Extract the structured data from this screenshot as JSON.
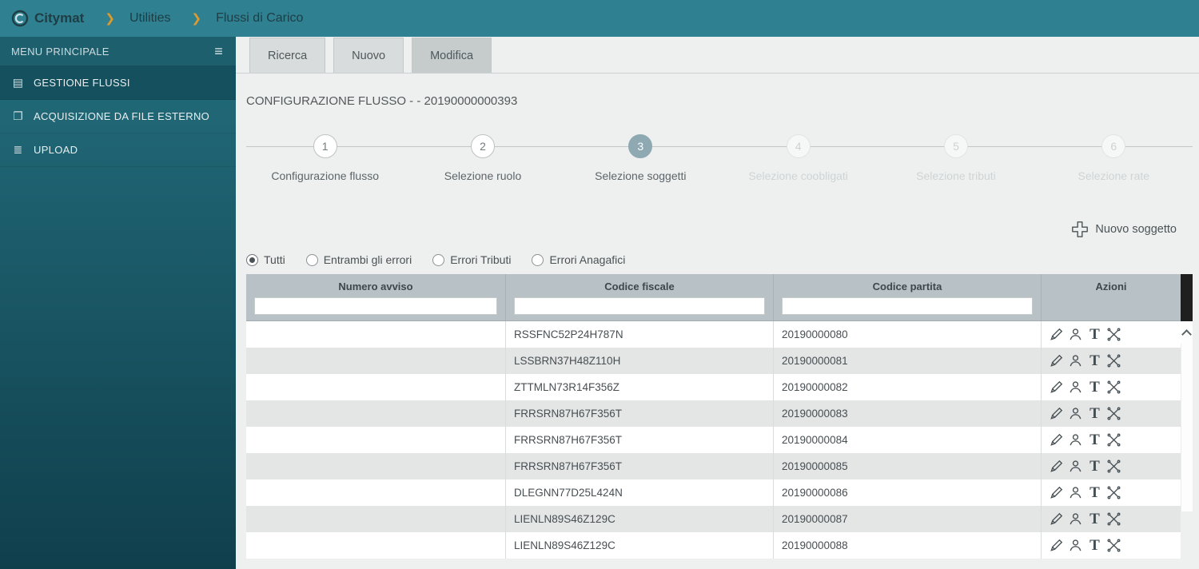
{
  "topbar": {
    "brand": "Citymat",
    "breadcrumbs": [
      {
        "label": "Utilities"
      },
      {
        "label": "Flussi di Carico"
      }
    ]
  },
  "sidebar": {
    "title": "MENU PRINCIPALE",
    "items": [
      {
        "label": "GESTIONE FLUSSI",
        "icon": "list",
        "active": true
      },
      {
        "label": "ACQUISIZIONE DA FILE ESTERNO",
        "icon": "file",
        "active": false
      },
      {
        "label": "UPLOAD",
        "icon": "upload",
        "active": false
      }
    ]
  },
  "tabs": [
    {
      "label": "Ricerca",
      "active": false
    },
    {
      "label": "Nuovo",
      "active": false
    },
    {
      "label": "Modifica",
      "active": true
    }
  ],
  "page_title": "CONFIGURAZIONE FLUSSO - - 20190000000393",
  "stepper": [
    {
      "number": "1",
      "label": "Configurazione flusso",
      "state": "done"
    },
    {
      "number": "2",
      "label": "Selezione ruolo",
      "state": "done"
    },
    {
      "number": "3",
      "label": "Selezione soggetti",
      "state": "active"
    },
    {
      "number": "4",
      "label": "Selezione coobligati",
      "state": "disabled"
    },
    {
      "number": "5",
      "label": "Selezione tributi",
      "state": "disabled"
    },
    {
      "number": "6",
      "label": "Selezione rate",
      "state": "disabled"
    }
  ],
  "new_subject": {
    "label": "Nuovo soggetto",
    "icon": "plus-icon"
  },
  "filters": [
    {
      "label": "Tutti",
      "checked": true
    },
    {
      "label": "Entrambi gli errori",
      "checked": false
    },
    {
      "label": "Errori Tributi",
      "checked": false
    },
    {
      "label": "Errori Anagafici",
      "checked": false
    }
  ],
  "table": {
    "columns": [
      "Numero avviso",
      "Codice fiscale",
      "Codice partita",
      "Azioni"
    ],
    "filter_values": {
      "numero_avviso": "",
      "codice_fiscale": "",
      "codice_partita": ""
    },
    "action_icons": [
      "edit-icon",
      "person-icon",
      "tributi-icon",
      "remove-icon"
    ],
    "rows": [
      {
        "avviso": "",
        "cf": "RSSFNC52P24H787N",
        "partita": "20190000080"
      },
      {
        "avviso": "",
        "cf": "LSSBRN37H48Z110H",
        "partita": "20190000081"
      },
      {
        "avviso": "",
        "cf": "ZTTMLN73R14F356Z",
        "partita": "20190000082"
      },
      {
        "avviso": "",
        "cf": "FRRSRN87H67F356T",
        "partita": "20190000083"
      },
      {
        "avviso": "",
        "cf": "FRRSRN87H67F356T",
        "partita": "20190000084"
      },
      {
        "avviso": "",
        "cf": "FRRSRN87H67F356T",
        "partita": "20190000085"
      },
      {
        "avviso": "",
        "cf": "DLEGNN77D25L424N",
        "partita": "20190000086"
      },
      {
        "avviso": "",
        "cf": "LIENLN89S46Z129C",
        "partita": "20190000087"
      },
      {
        "avviso": "",
        "cf": "LIENLN89S46Z129C",
        "partita": "20190000088"
      }
    ]
  },
  "colors": {
    "topbar_teal": "#2f8090",
    "sidebar_dark_teal": "#14505d",
    "breadcrumb_chevron_orange": "#df9a2e",
    "table_header_gray": "#b8c1c5",
    "row_alt_gray": "#e4e5e5",
    "active_step_teal_gray": "#8ea9b1"
  }
}
